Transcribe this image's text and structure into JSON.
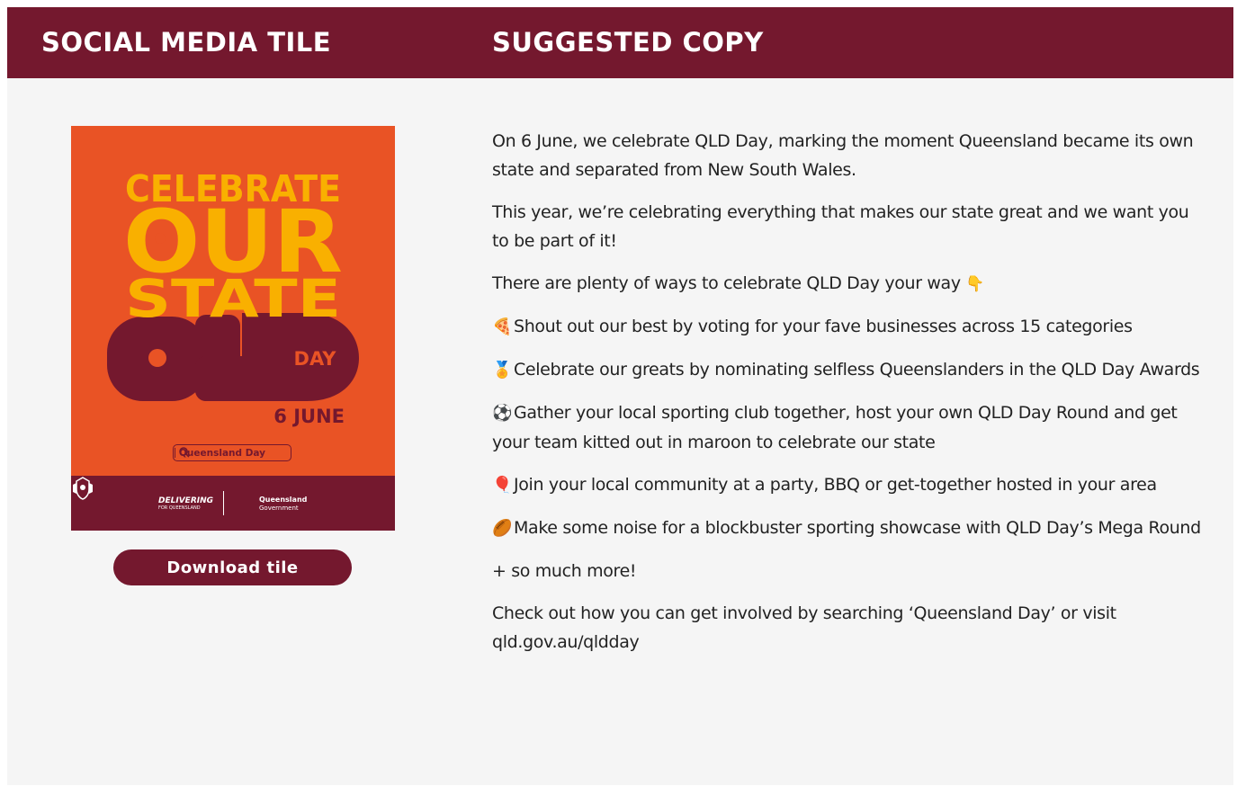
{
  "header": {
    "left_title": "SOCIAL MEDIA TILE",
    "right_title": "SUGGESTED COPY"
  },
  "tile": {
    "line1": "CELEBRATE",
    "line2": "OUR",
    "line3": "STATE",
    "line4": "QLD",
    "day": "DAY",
    "date": "6 JUNE",
    "search_text": "Queensland Day",
    "brand": "DELIVERING",
    "brand_sub": "FOR QUEENSLAND",
    "gov_name": "Queensland",
    "gov_sub": "Government",
    "colors": {
      "background": "#e95325",
      "yellow": "#f9b000",
      "maroon": "#74182e"
    }
  },
  "download_button": "Download tile",
  "copy": {
    "intro": "On 6 June, we celebrate QLD Day, marking the moment Queensland became its own state and separated from New South Wales.",
    "para2": "This year, we’re celebrating everything that makes our state great and we want you to be part of it!",
    "para3": "There are plenty of ways to celebrate QLD Day your way",
    "items": [
      {
        "emoji": "🍕",
        "text": "Shout out our best by voting for your fave businesses across 15 categories"
      },
      {
        "emoji": "🏅",
        "text": "Celebrate our greats by nominating selfless Queenslanders in the QLD Day Awards"
      },
      {
        "emoji": "⚽",
        "text": "Gather your local sporting club together, host your own QLD Day Round and get your team kitted out in maroon to celebrate our state"
      },
      {
        "emoji": "🎈",
        "text": "Join your local community at a party, BBQ or get-together hosted in your area"
      },
      {
        "emoji": "🏉",
        "text": "Make some noise for a blockbuster sporting showcase with QLD Day’s Mega Round"
      }
    ],
    "more": "+ so much more!",
    "cta": "Check out how you can get involved by searching  ‘Queensland Day’ or visit qld.gov.au/qldday"
  },
  "colors": {
    "header_bg": "#74182e",
    "panel_bg": "#f5f5f5",
    "text": "#222222"
  }
}
